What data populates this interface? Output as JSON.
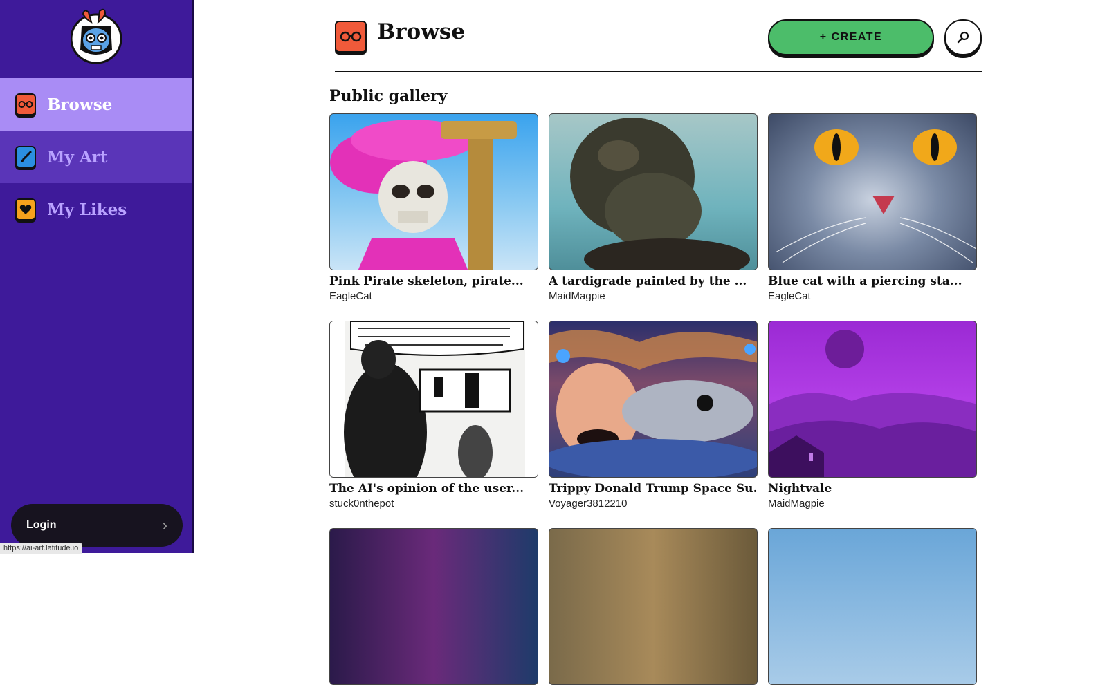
{
  "sidebar": {
    "logo": "skull-mascot-logo",
    "items": [
      {
        "label": "Browse",
        "icon": "glasses-icon",
        "icon_color": "#f05a3a",
        "active": true
      },
      {
        "label": "My Art",
        "icon": "brush-icon",
        "icon_color": "#2b8fe0",
        "active": false
      },
      {
        "label": "My Likes",
        "icon": "heart-icon",
        "icon_color": "#f7a21c",
        "active": false
      }
    ],
    "login_label": "Login",
    "login_chevron": "›"
  },
  "status_url": "https://ai-art.latitude.io",
  "header": {
    "title": "Browse",
    "create_label": "+ CREATE",
    "search_icon": "search-icon"
  },
  "gallery": {
    "title": "Public gallery",
    "cards": [
      {
        "title": "Pink Pirate skeleton, pirate...",
        "author": "EagleCat"
      },
      {
        "title": "A tardigrade painted by the ...",
        "author": "MaidMagpie"
      },
      {
        "title": "Blue cat with a piercing sta...",
        "author": "EagleCat"
      },
      {
        "title": "The AI's opinion of the user...",
        "author": "stuck0nthepot"
      },
      {
        "title": "Trippy Donald Trump Space Su...",
        "author": "Voyager3812210"
      },
      {
        "title": "Nightvale",
        "author": "MaidMagpie"
      }
    ]
  },
  "colors": {
    "sidebar_bg": "#3e1a9a",
    "active_nav": "#a98cf5",
    "create_green": "#4cbd6a"
  }
}
